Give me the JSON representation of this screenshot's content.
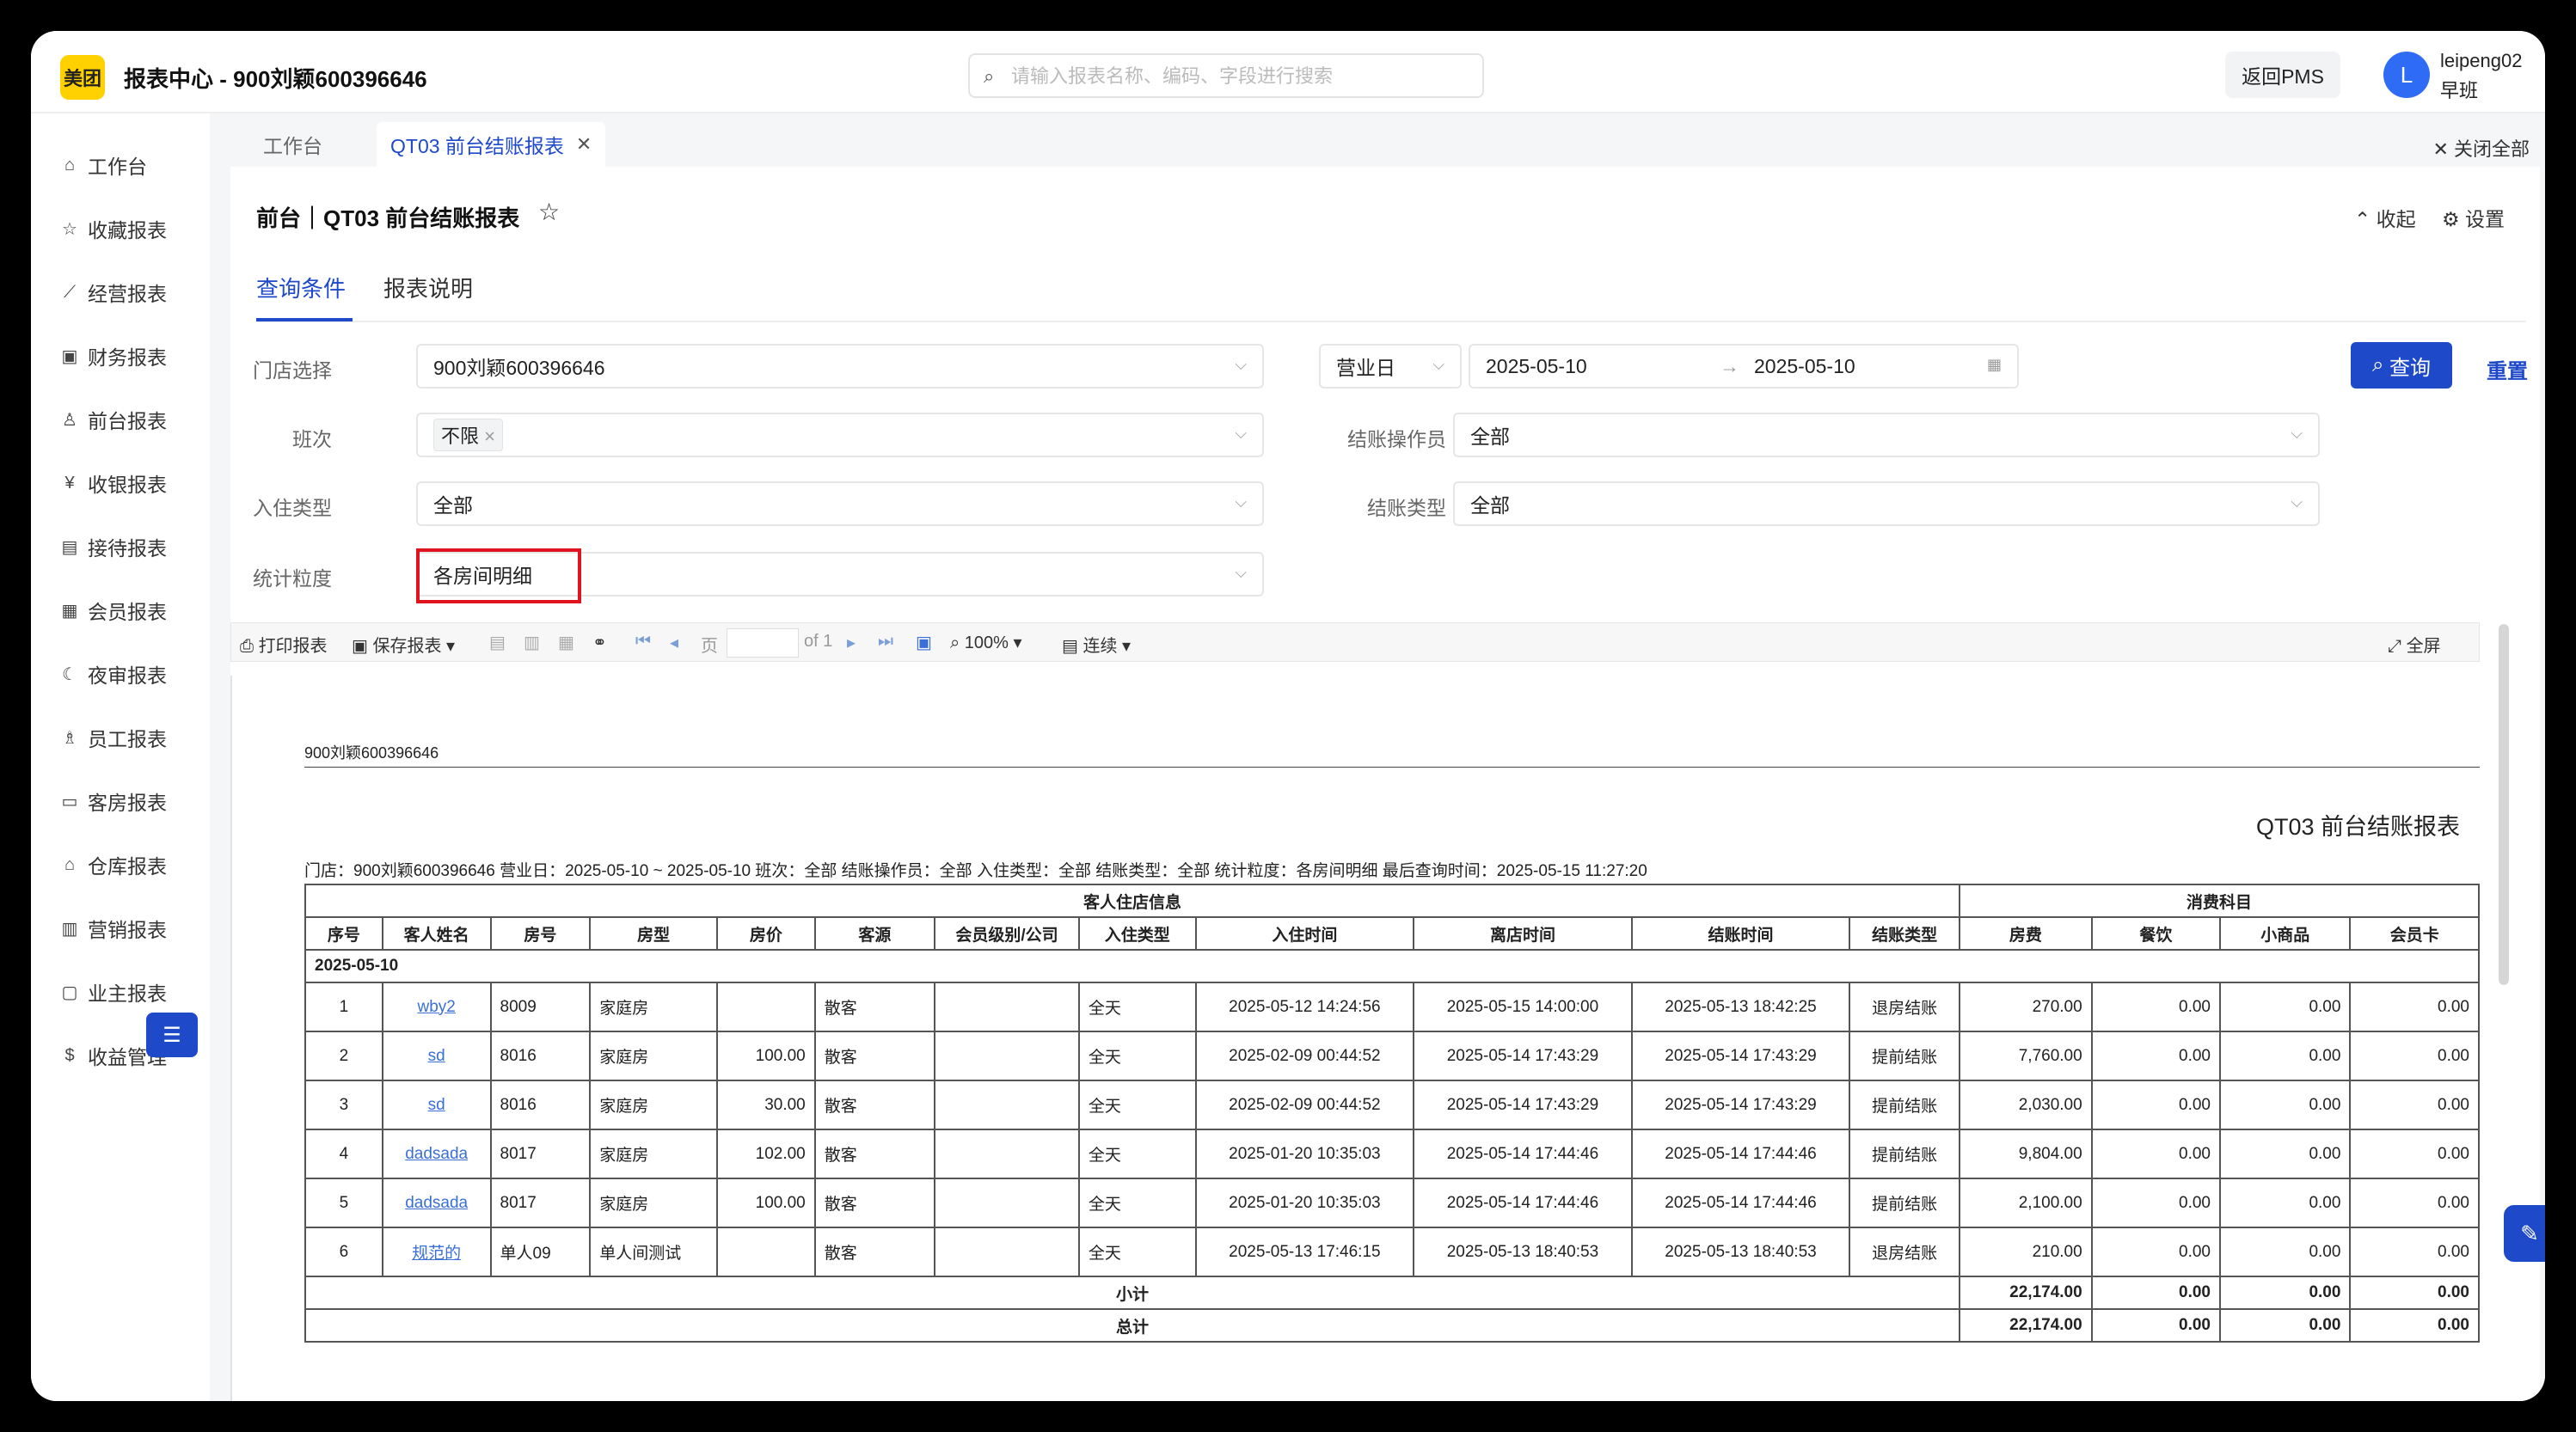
{
  "app": {
    "logo": "美团",
    "title": "报表中心 - 900刘颖600396646"
  },
  "search": {
    "placeholder": "请输入报表名称、编码、字段进行搜索"
  },
  "header": {
    "back_pms": "返回PMS",
    "avatar_letter": "L",
    "user_name": "leipeng02",
    "shift": "早班"
  },
  "sidebar": {
    "items": [
      {
        "icon": "home-icon",
        "label": "工作台"
      },
      {
        "icon": "star-icon",
        "label": "收藏报表"
      },
      {
        "icon": "chart-line-icon",
        "label": "经营报表"
      },
      {
        "icon": "finance-icon",
        "label": "财务报表"
      },
      {
        "icon": "person-icon",
        "label": "前台报表"
      },
      {
        "icon": "yen-icon",
        "label": "收银报表"
      },
      {
        "icon": "reception-icon",
        "label": "接待报表"
      },
      {
        "icon": "member-icon",
        "label": "会员报表"
      },
      {
        "icon": "moon-icon",
        "label": "夜审报表"
      },
      {
        "icon": "staff-icon",
        "label": "员工报表"
      },
      {
        "icon": "room-icon",
        "label": "客房报表"
      },
      {
        "icon": "warehouse-icon",
        "label": "仓库报表"
      },
      {
        "icon": "marketing-icon",
        "label": "营销报表"
      },
      {
        "icon": "owner-icon",
        "label": "业主报表"
      },
      {
        "icon": "revenue-icon",
        "label": "收益管理"
      }
    ]
  },
  "tabs": [
    {
      "label": "工作台"
    },
    {
      "label": "QT03 前台结账报表"
    }
  ],
  "close_all": "关闭全部",
  "page": {
    "title": "前台｜QT03 前台结账报表",
    "collapse": "收起",
    "settings": "设置"
  },
  "subtabs": {
    "query": "查询条件",
    "desc": "报表说明"
  },
  "form": {
    "store_label": "门店选择",
    "store_value": "900刘颖600396646",
    "date_type": "营业日",
    "date_start": "2025-05-10",
    "date_end": "2025-05-10",
    "shift_label": "班次",
    "shift_tag": "不限",
    "operator_label": "结账操作员",
    "operator_value": "全部",
    "checkin_label": "入住类型",
    "checkin_value": "全部",
    "checkout_label": "结账类型",
    "checkout_value": "全部",
    "grain_label": "统计粒度",
    "grain_value": "各房间明细",
    "query_btn": "查询",
    "reset_btn": "重置"
  },
  "toolbar": {
    "print": "打印报表",
    "save": "保存报表",
    "page_label": "页",
    "of": "of 1",
    "zoom": "100%",
    "mode": "连续",
    "fullscreen": "全屏"
  },
  "report": {
    "store_name": "900刘颖600396646",
    "title": "QT03 前台结账报表",
    "criteria": "门店：900刘颖600396646    营业日：2025-05-10 ~ 2025-05-10    班次：全部    结账操作员：全部    入住类型：全部    结账类型：全部    统计粒度：各房间明细    最后查询时间：2025-05-15 11:27:20",
    "group1": "客人住店信息",
    "group2": "消费科目",
    "columns": [
      "序号",
      "客人姓名",
      "房号",
      "房型",
      "房价",
      "客源",
      "会员级别/公司",
      "入住类型",
      "入住时间",
      "离店时间",
      "结账时间",
      "结账类型",
      "房费",
      "餐饮",
      "小商品",
      "会员卡"
    ],
    "date_group": "2025-05-10",
    "rows": [
      {
        "no": "1",
        "name": "wby2",
        "room": "8009",
        "type": "家庭房",
        "price": "",
        "source": "散客",
        "member": "",
        "checkin_type": "全天",
        "in": "2025-05-12 14:24:56",
        "out": "2025-05-15 14:00:00",
        "settle": "2025-05-13 18:42:25",
        "settle_type": "退房结账",
        "room_fee": "270.00",
        "food": "0.00",
        "goods": "0.00",
        "card": "0.00"
      },
      {
        "no": "2",
        "name": "sd",
        "room": "8016",
        "type": "家庭房",
        "price": "100.00",
        "source": "散客",
        "member": "",
        "checkin_type": "全天",
        "in": "2025-02-09 00:44:52",
        "out": "2025-05-14 17:43:29",
        "settle": "2025-05-14 17:43:29",
        "settle_type": "提前结账",
        "room_fee": "7,760.00",
        "food": "0.00",
        "goods": "0.00",
        "card": "0.00"
      },
      {
        "no": "3",
        "name": "sd",
        "room": "8016",
        "type": "家庭房",
        "price": "30.00",
        "source": "散客",
        "member": "",
        "checkin_type": "全天",
        "in": "2025-02-09 00:44:52",
        "out": "2025-05-14 17:43:29",
        "settle": "2025-05-14 17:43:29",
        "settle_type": "提前结账",
        "room_fee": "2,030.00",
        "food": "0.00",
        "goods": "0.00",
        "card": "0.00"
      },
      {
        "no": "4",
        "name": "dadsada",
        "room": "8017",
        "type": "家庭房",
        "price": "102.00",
        "source": "散客",
        "member": "",
        "checkin_type": "全天",
        "in": "2025-01-20 10:35:03",
        "out": "2025-05-14 17:44:46",
        "settle": "2025-05-14 17:44:46",
        "settle_type": "提前结账",
        "room_fee": "9,804.00",
        "food": "0.00",
        "goods": "0.00",
        "card": "0.00"
      },
      {
        "no": "5",
        "name": "dadsada",
        "room": "8017",
        "type": "家庭房",
        "price": "100.00",
        "source": "散客",
        "member": "",
        "checkin_type": "全天",
        "in": "2025-01-20 10:35:03",
        "out": "2025-05-14 17:44:46",
        "settle": "2025-05-14 17:44:46",
        "settle_type": "提前结账",
        "room_fee": "2,100.00",
        "food": "0.00",
        "goods": "0.00",
        "card": "0.00"
      },
      {
        "no": "6",
        "name": "规范的",
        "room": "单人09",
        "type": "单人间测试",
        "price": "",
        "source": "散客",
        "member": "",
        "checkin_type": "全天",
        "in": "2025-05-13 17:46:15",
        "out": "2025-05-13 18:40:53",
        "settle": "2025-05-13 18:40:53",
        "settle_type": "退房结账",
        "room_fee": "210.00",
        "food": "0.00",
        "goods": "0.00",
        "card": "0.00"
      }
    ],
    "subtotal": {
      "label": "小计",
      "room_fee": "22,174.00",
      "food": "0.00",
      "goods": "0.00",
      "card": "0.00"
    },
    "total": {
      "label": "总计",
      "room_fee": "22,174.00",
      "food": "0.00",
      "goods": "0.00",
      "card": "0.00"
    }
  },
  "colors": {
    "primary": "#1e49c9",
    "highlight_border": "#e0141e",
    "logo_bg": "#ffd100"
  }
}
